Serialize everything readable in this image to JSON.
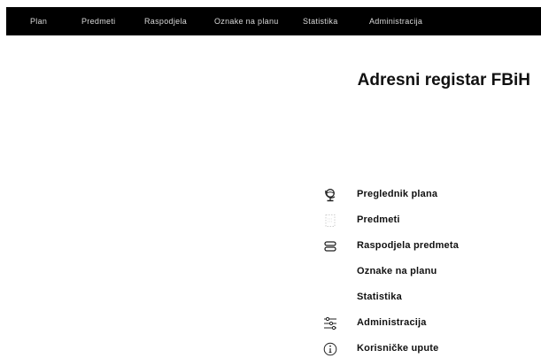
{
  "nav": {
    "items": [
      {
        "label": "Plan"
      },
      {
        "label": "Predmeti"
      },
      {
        "label": "Raspodjela"
      },
      {
        "label": "Oznake na planu"
      },
      {
        "label": "Statistika"
      },
      {
        "label": "Administracija"
      }
    ]
  },
  "main": {
    "title": "Adresni registar FBiH",
    "menu": [
      {
        "label": "Preglednik plana",
        "icon": "globe-icon"
      },
      {
        "label": "Predmeti",
        "icon": "document-icon"
      },
      {
        "label": "Raspodjela predmeta",
        "icon": "stack-icon"
      },
      {
        "label": "Oznake na planu",
        "icon": ""
      },
      {
        "label": "Statistika",
        "icon": ""
      },
      {
        "label": "Administracija",
        "icon": "sliders-icon"
      },
      {
        "label": "Korisničke upute",
        "icon": "info-icon"
      }
    ]
  }
}
